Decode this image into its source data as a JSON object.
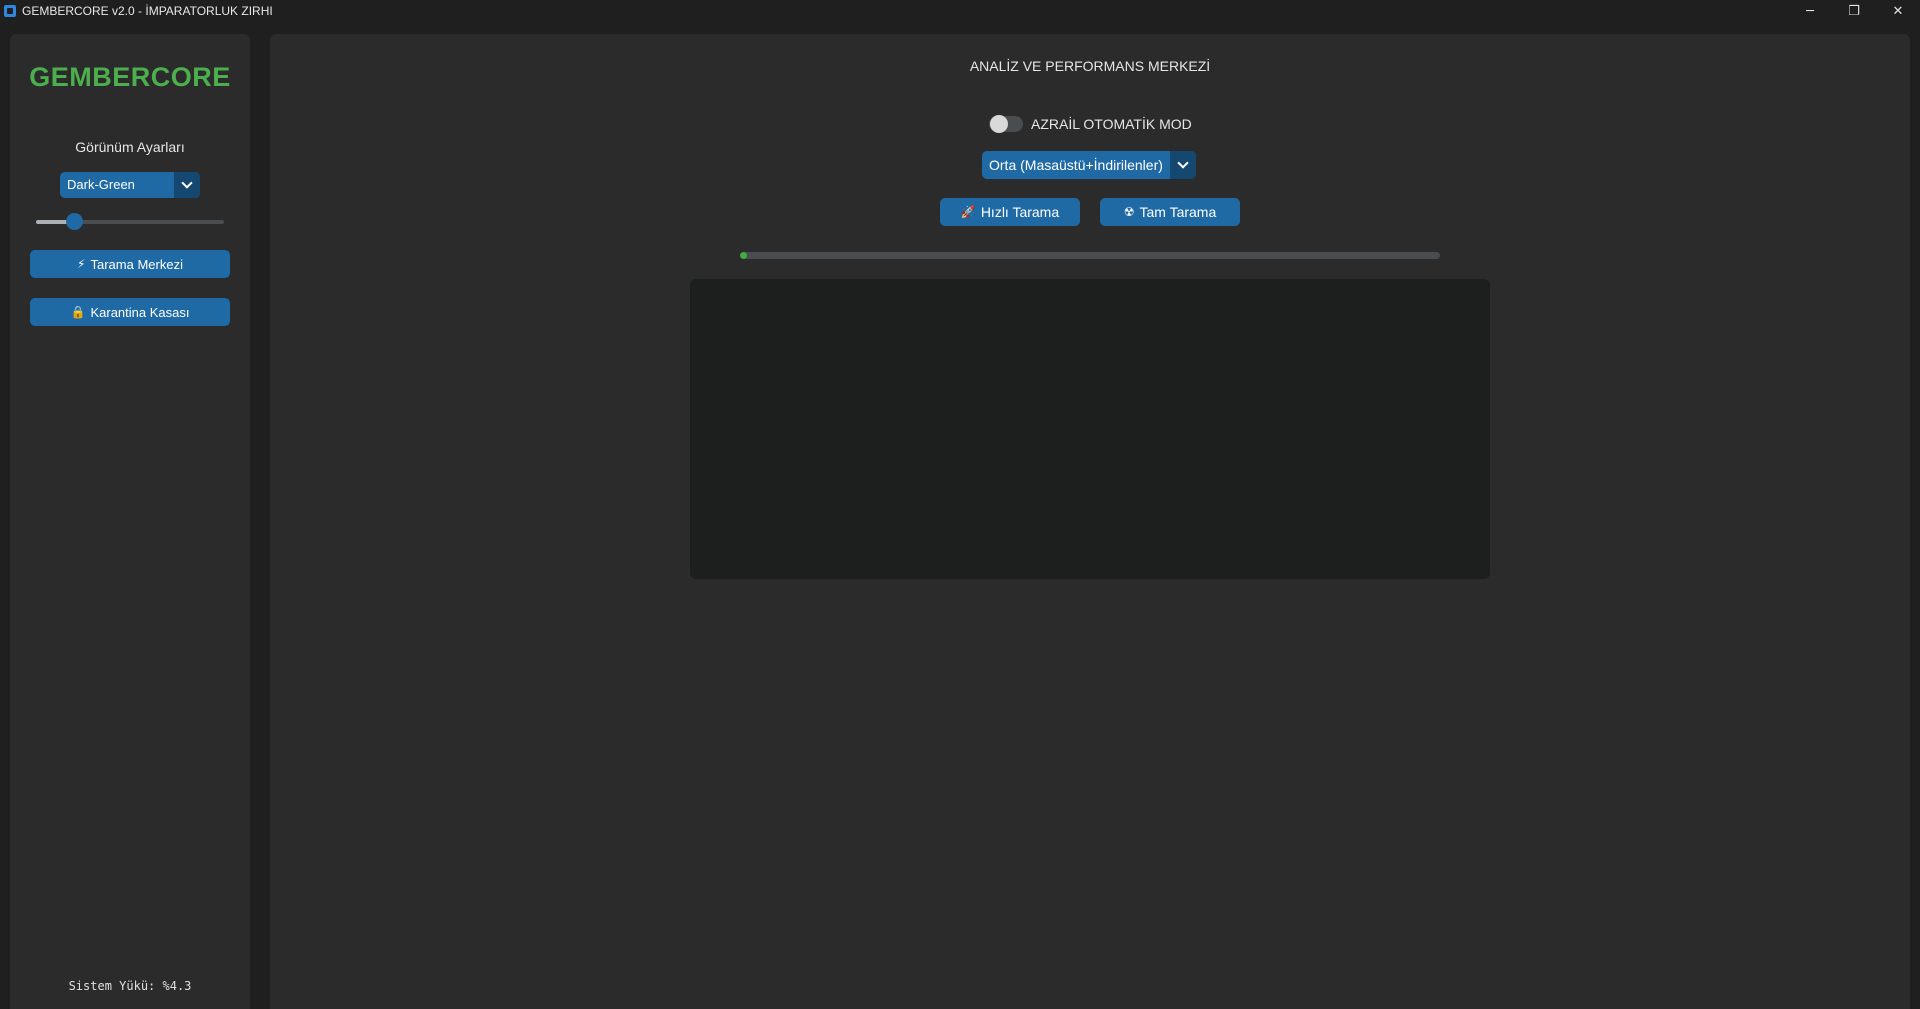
{
  "window": {
    "title": "GEMBERCORE v2.0 - İMPARATORLUK ZIRHI",
    "controls": {
      "minimize": "─",
      "restore": "❐",
      "close": "✕"
    }
  },
  "sidebar": {
    "brand": "GEMBERCORE",
    "appearance_label": "Görünüm Ayarları",
    "theme_select": {
      "value": "Dark-Green"
    },
    "scale_slider": {
      "level_fraction": 0.2
    },
    "buttons": [
      {
        "icon": "⚡",
        "label": "Tarama Merkezi"
      },
      {
        "icon": "🔒",
        "label": "Karantina Kasası"
      }
    ],
    "system_load": "Sistem Yükü: %4.3"
  },
  "main": {
    "title": "ANALİZ VE PERFORMANS MERKEZİ",
    "auto_mode": {
      "label": "AZRAİL OTOMATİK MOD",
      "enabled": false
    },
    "scan_depth": {
      "value": "Orta (Masaüstü+İndirilenler)"
    },
    "buttons": [
      {
        "icon": "🚀",
        "label": "Hızlı Tarama"
      },
      {
        "icon": "☢",
        "label": "Tam Tarama"
      }
    ],
    "progress_fraction": 0.01,
    "log_text": ""
  },
  "colors": {
    "accent": "#1f6aa5",
    "brand_green": "#4cae4c",
    "progress_green": "#3fae3f",
    "panel": "#2b2b2b",
    "background": "#1f1f1f"
  }
}
